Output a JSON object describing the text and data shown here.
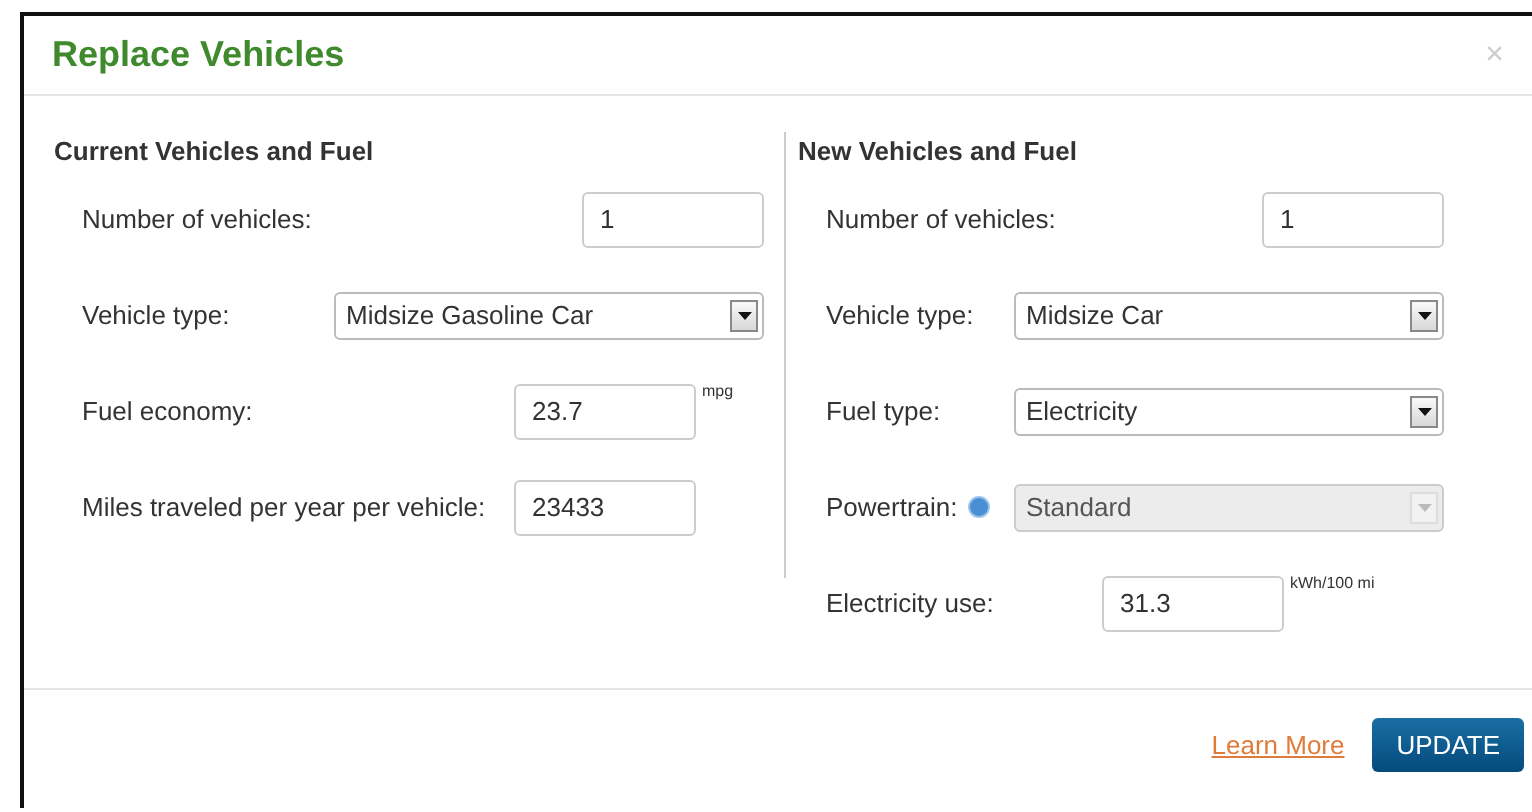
{
  "dialog": {
    "title": "Replace Vehicles",
    "close": "×"
  },
  "columns": [
    {
      "title": "Current Vehicles and Fuel",
      "fields": [
        {
          "kind": "number",
          "label": "Number of vehicles:",
          "value": "1"
        },
        {
          "kind": "select",
          "label": "Vehicle type:",
          "value": "Midsize Gasoline Car",
          "disabled": false
        },
        {
          "kind": "measure",
          "label": "Fuel economy:",
          "value": "23.7",
          "unit": "mpg"
        },
        {
          "kind": "measure",
          "label": "Miles traveled per year per vehicle:",
          "value": "23433"
        }
      ]
    },
    {
      "title": "New Vehicles and Fuel",
      "fields": [
        {
          "kind": "number",
          "label": "Number of vehicles:",
          "value": "1"
        },
        {
          "kind": "select",
          "label": "Vehicle type:",
          "value": "Midsize Car",
          "disabled": false
        },
        {
          "kind": "select",
          "label": "Fuel type:",
          "value": "Electricity",
          "disabled": false
        },
        {
          "kind": "select",
          "label": "Powertrain:",
          "value": "Standard",
          "disabled": true,
          "help": true
        },
        {
          "kind": "measure",
          "label": "Electricity use:",
          "value": "31.3",
          "unit": "kWh/100 mi"
        }
      ]
    }
  ],
  "footer": {
    "link": "Learn More",
    "button": "UPDATE"
  }
}
